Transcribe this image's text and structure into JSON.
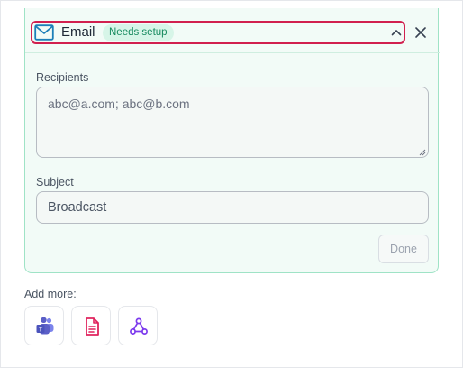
{
  "email_card": {
    "icon": "mail-icon",
    "title": "Email",
    "status_badge": "Needs setup",
    "collapse_icon": "chevron-up-icon",
    "close_icon": "close-icon",
    "recipients": {
      "label": "Recipients",
      "value": "abc@a.com; abc@b.com"
    },
    "subject": {
      "label": "Subject",
      "value": "Broadcast"
    },
    "done_label": "Done"
  },
  "add_more": {
    "label": "Add more:",
    "options": [
      {
        "icon": "teams-icon"
      },
      {
        "icon": "document-icon"
      },
      {
        "icon": "webhook-icon"
      }
    ]
  },
  "colors": {
    "accent_highlight": "#d1204f",
    "card_background": "#f2fbf7",
    "card_border": "#9fe3c6",
    "badge_background": "#d7f5e8",
    "badge_text": "#168a5e",
    "mail_icon": "#1c7fb8",
    "teams_icon": "#5b5fc7",
    "document_icon": "#e0245e",
    "webhook_icon": "#7c3aed"
  }
}
